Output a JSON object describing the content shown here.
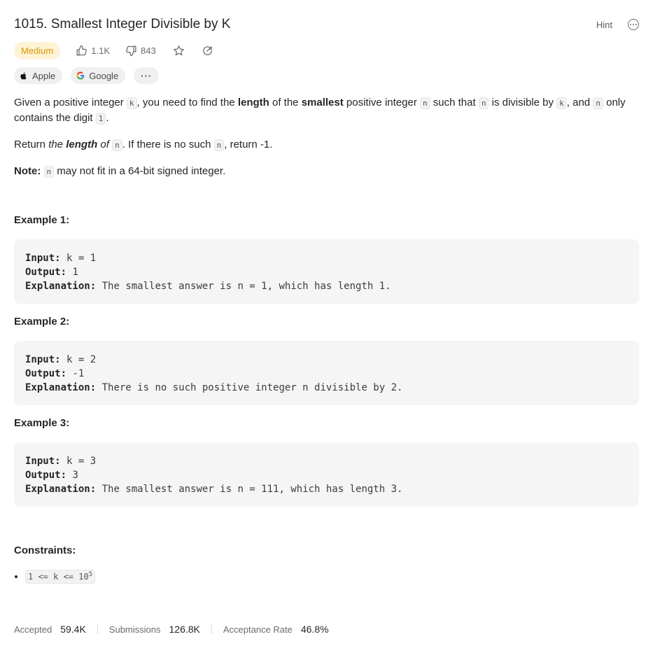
{
  "problem": {
    "title": "1015. Smallest Integer Divisible by K",
    "hint_label": "Hint",
    "difficulty": "Medium",
    "likes": "1.1K",
    "dislikes": "843",
    "companies": [
      "Apple",
      "Google"
    ],
    "more_tags": "···"
  },
  "description": {
    "p1_a": "Given a positive integer ",
    "p1_k": "k",
    "p1_b": ", you need to find the ",
    "p1_length": "length",
    "p1_c": " of the ",
    "p1_smallest": "smallest",
    "p1_d": " positive integer ",
    "p1_n1": "n",
    "p1_e": " such that ",
    "p1_n2": "n",
    "p1_f": " is divisible by ",
    "p1_k2": "k",
    "p1_g": ", and ",
    "p1_n3": "n",
    "p1_h": " only contains the digit ",
    "p1_one": "1",
    "p1_i": ".",
    "p2_a": "Return ",
    "p2_the": "the ",
    "p2_length": "length",
    "p2_of": " of ",
    "p2_n": "n",
    "p2_b": ". If there is no such ",
    "p2_n2": "n",
    "p2_c": ", return -1.",
    "note_label": "Note:",
    "note_n": "n",
    "note_text": " may not fit in a 64-bit signed integer."
  },
  "examples": [
    {
      "heading": "Example 1:",
      "input_label": "Input:",
      "input": " k = 1",
      "output_label": "Output:",
      "output": " 1",
      "explanation_label": "Explanation:",
      "explanation": " The smallest answer is n = 1, which has length 1."
    },
    {
      "heading": "Example 2:",
      "input_label": "Input:",
      "input": " k = 2",
      "output_label": "Output:",
      "output": " -1",
      "explanation_label": "Explanation:",
      "explanation": " There is no such positive integer n divisible by 2."
    },
    {
      "heading": "Example 3:",
      "input_label": "Input:",
      "input": " k = 3",
      "output_label": "Output:",
      "output": " 3",
      "explanation_label": "Explanation:",
      "explanation": " The smallest answer is n = 111, which has length 3."
    }
  ],
  "constraints": {
    "heading": "Constraints:",
    "item_base": "1 <= k <= 10",
    "item_exp": "5"
  },
  "stats": {
    "accepted_label": "Accepted",
    "accepted": "59.4K",
    "submissions_label": "Submissions",
    "submissions": "126.8K",
    "rate_label": "Acceptance Rate",
    "rate": "46.8%"
  },
  "colors": {
    "difficulty_bg": "#fff3d6",
    "difficulty_text": "#d99800",
    "code_bg": "#f5f5f5"
  },
  "icons": [
    "thumbs-up-icon",
    "thumbs-down-icon",
    "star-icon",
    "share-icon",
    "more-icon",
    "apple-icon",
    "google-icon"
  ]
}
